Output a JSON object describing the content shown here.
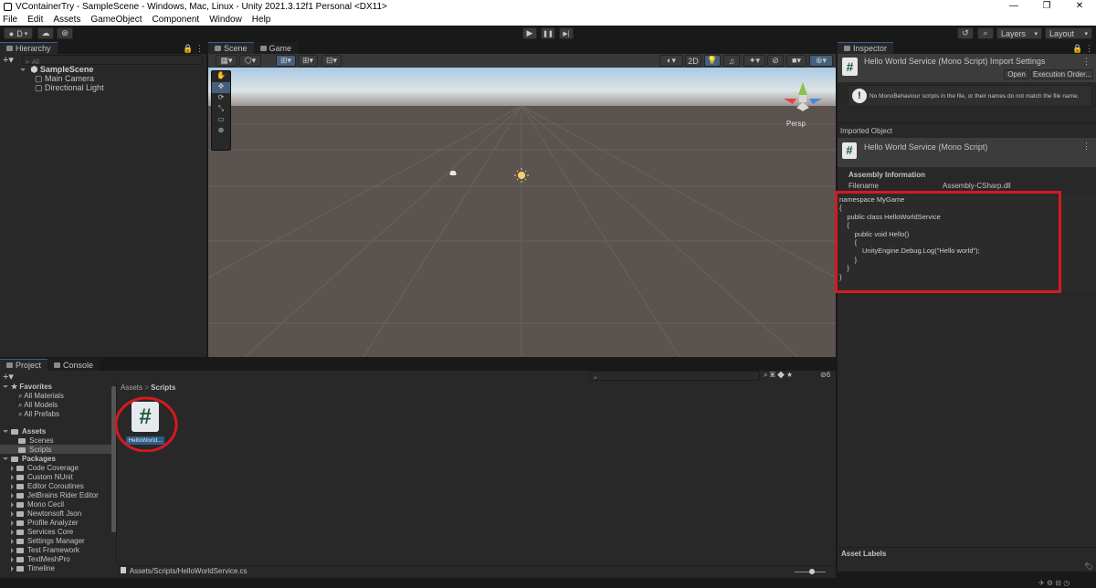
{
  "window": {
    "title": "VContainerTry - SampleScene - Windows, Mac, Linux - Unity 2021.3.12f1 Personal <DX11>",
    "minimize": "—",
    "maximize": "❐",
    "close": "✕"
  },
  "menu": [
    "File",
    "Edit",
    "Assets",
    "GameObject",
    "Component",
    "Window",
    "Help"
  ],
  "toolbar": {
    "account": "D",
    "layers": "Layers",
    "layout": "Layout",
    "play": "▶",
    "pause": "❚❚",
    "step": "▶|"
  },
  "hierarchy": {
    "tab": "Hierarchy",
    "search_placeholder": "All",
    "scene": "SampleScene",
    "items": [
      "Main Camera",
      "Directional Light"
    ]
  },
  "scene_view": {
    "tabs": [
      "Scene",
      "Game"
    ],
    "persp_label": "Persp",
    "mode_2d": "2D"
  },
  "inspector": {
    "tab": "Inspector",
    "title": "Hello World Service (Mono Script) Import Settings",
    "open_btn": "Open",
    "exec_btn": "Execution Order...",
    "warning": "No MonoBehaviour scripts in the file, or their names do not match the file name.",
    "imported_object": "Imported Object",
    "script_name": "Hello World Service (Mono Script)",
    "assembly_info": "Assembly Information",
    "filename_label": "Filename",
    "filename_value": "Assembly-CSharp.dll",
    "code": [
      "namespace MyGame",
      "{",
      "    public class HelloWorldService",
      "    {",
      "        public void Hello()",
      "        {",
      "            UnityEngine.Debug.Log(\"Hello world\");",
      "        }",
      "    }",
      "}"
    ],
    "asset_labels": "Asset Labels"
  },
  "project": {
    "tabs": [
      "Project",
      "Console"
    ],
    "favorites": "Favorites",
    "favorite_items": [
      "All Materials",
      "All Models",
      "All Prefabs"
    ],
    "assets": "Assets",
    "asset_folders": [
      "Scenes",
      "Scripts"
    ],
    "packages": "Packages",
    "package_items": [
      "Code Coverage",
      "Custom NUnit",
      "Editor Coroutines",
      "JetBrains Rider Editor",
      "Mono Cecil",
      "Newtonsoft Json",
      "Profile Analyzer",
      "Services Core",
      "Settings Manager",
      "Test Framework",
      "TextMeshPro",
      "Timeline"
    ],
    "breadcrumb_root": "Assets",
    "breadcrumb_sep": ">",
    "breadcrumb_current": "Scripts",
    "file_label": "HelloWorld...",
    "hidden_count": "6",
    "status_path": "Assets/Scripts/HelloWorldService.cs"
  },
  "colors": {
    "highlight_red": "#d7191f",
    "selection_blue": "#2c5d87"
  }
}
